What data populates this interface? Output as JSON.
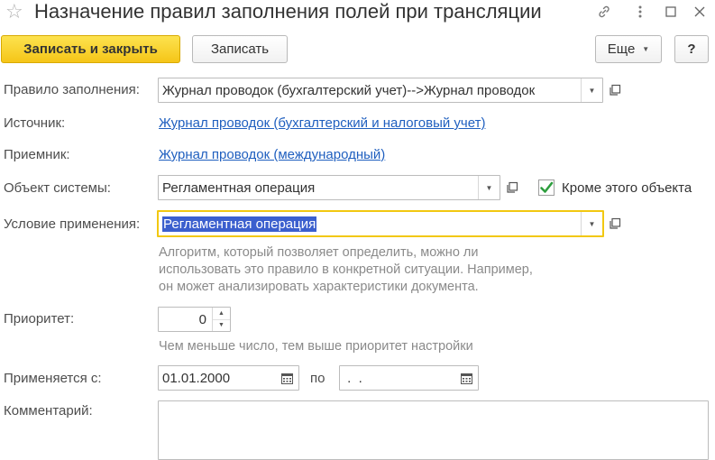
{
  "window": {
    "title": "Назначение правил заполнения полей при трансляции"
  },
  "toolbar": {
    "save_close_label": "Записать и закрыть",
    "save_label": "Записать",
    "more_label": "Еще",
    "help_label": "?"
  },
  "form": {
    "rule": {
      "label": "Правило заполнения:",
      "value": "Журнал проводок (бухгалтерский учет)-->Журнал проводок"
    },
    "source": {
      "label": "Источник:",
      "value": "Журнал проводок (бухгалтерский и налоговый учет)"
    },
    "receiver": {
      "label": "Приемник:",
      "value": "Журнал проводок (международный)"
    },
    "system_object": {
      "label": "Объект системы:",
      "value": "Регламентная операция",
      "except_label": "Кроме этого объекта",
      "except_checked": true
    },
    "condition": {
      "label": "Условие применения:",
      "value": "Регламентная операция",
      "hint_line1": "Алгоритм, который позволяет определить, можно ли",
      "hint_line2": "использовать это правило в конкретной ситуации. Например,",
      "hint_line3": "он может анализировать характеристики документа."
    },
    "priority": {
      "label": "Приоритет:",
      "value": "0",
      "hint": "Чем меньше число, тем выше приоритет настройки"
    },
    "applies_from": {
      "label": "Применяется с:",
      "from_value": "01.01.2000",
      "to_label": "по",
      "to_value": " .  ."
    },
    "comment": {
      "label": "Комментарий:",
      "value": ""
    }
  }
}
